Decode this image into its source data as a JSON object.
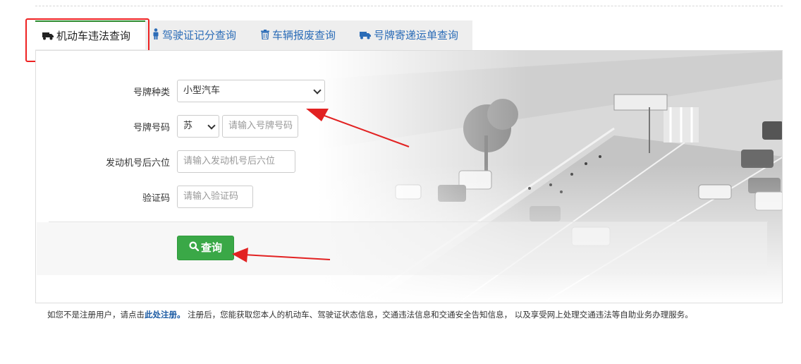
{
  "tabs": [
    {
      "label": "机动车违法查询",
      "icon": "truck-icon",
      "active": true
    },
    {
      "label": "驾驶证记分查询",
      "icon": "person-icon",
      "active": false
    },
    {
      "label": "车辆报废查询",
      "icon": "trash-icon",
      "active": false
    },
    {
      "label": "号牌寄递运单查询",
      "icon": "truck-icon",
      "active": false
    }
  ],
  "form": {
    "plate_type_label": "号牌种类",
    "plate_type_value": "小型汽车",
    "plate_number_label": "号牌号码",
    "province_value": "苏",
    "plate_number_placeholder": "请输入号牌号码",
    "engine_label": "发动机号后六位",
    "engine_placeholder": "请输入发动机号后六位",
    "captcha_label": "验证码",
    "captcha_placeholder": "请输入验证码",
    "search_button": "查询"
  },
  "footer": {
    "prefix": "如您不是注册用户，请点击",
    "link": "此处注册。",
    "suffix": " 注册后，您能获取您本人的机动车、驾驶证状态信息，交通违法信息和交通安全告知信息， 以及享受网上处理交通违法等自助业务办理服务。"
  },
  "colors": {
    "tab_link": "#2b6cb7",
    "active_tab_border": "#2e8a2e",
    "search_button": "#3aa847",
    "annotation": "#e22222"
  }
}
